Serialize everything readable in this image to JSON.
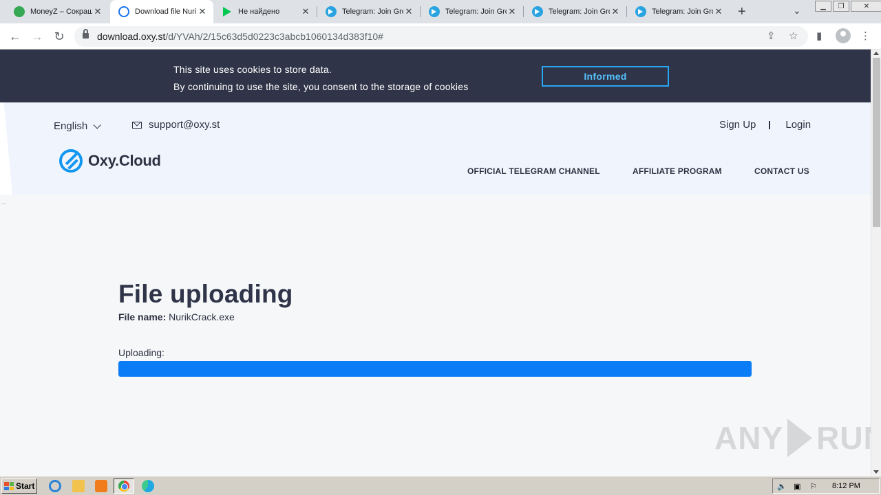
{
  "browser": {
    "tabs": [
      {
        "title": "MoneyZ – Сокраще",
        "icon": "moneyz-icon"
      },
      {
        "title": "Download file Nurik",
        "icon": "oxy-cloud-icon",
        "active": true
      },
      {
        "title": "Не найдено",
        "icon": "google-play-icon"
      },
      {
        "title": "Telegram: Join Gro",
        "icon": "telegram-icon"
      },
      {
        "title": "Telegram: Join Gro",
        "icon": "telegram-icon"
      },
      {
        "title": "Telegram: Join Gro",
        "icon": "telegram-icon"
      },
      {
        "title": "Telegram: Join Gro",
        "icon": "telegram-icon"
      }
    ],
    "url": {
      "host": "download.oxy.st",
      "path": "/d/YVAh/2/15c63d5d0223c3abcb1060134d383f10#"
    }
  },
  "cookie": {
    "line1": "This site uses cookies to store data.",
    "line2": "By continuing to use the site, you consent to the storage of cookies",
    "button": "Informed"
  },
  "header": {
    "language": "English",
    "email": "support@oxy.st",
    "signup": "Sign Up",
    "login": "Login",
    "logo_text": "Oxy.Cloud",
    "nav": [
      "OFFICIAL TELEGRAM CHANNEL",
      "AFFILIATE PROGRAM",
      "CONTACT US"
    ]
  },
  "page": {
    "dots": "...",
    "title": "File uploading",
    "file_label": "File name:",
    "file_name": "NurikCrack.exe",
    "uploading_label": "Uploading:",
    "progress_fraction": 1.0,
    "accent_color": "#0a7cf5"
  },
  "watermark": {
    "left": "ANY",
    "right": "RUN"
  },
  "taskbar": {
    "start": "Start",
    "time": "8:12 PM"
  }
}
